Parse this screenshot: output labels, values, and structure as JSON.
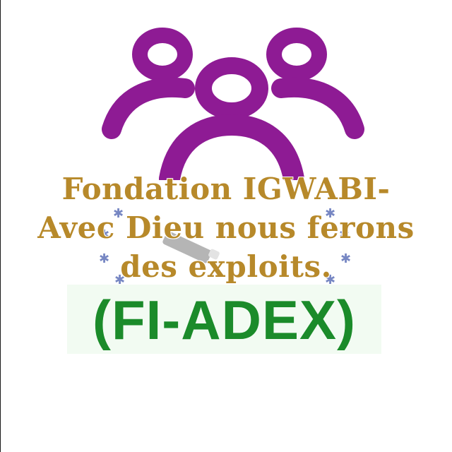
{
  "logo": {
    "icon": "three-people-icon",
    "primary_color": "#8e1b94"
  },
  "emblem": {
    "icon": "stars-circle-emblem-icon",
    "star_color": "#4a5fb0"
  },
  "title": {
    "line1": "Fondation IGWABI-",
    "line2": "Avec Dieu nous ferons",
    "line3": "des exploits.",
    "color": "#b7892a"
  },
  "acronym": {
    "text": "(FI-ADEX)",
    "color": "#1b8b2a"
  }
}
